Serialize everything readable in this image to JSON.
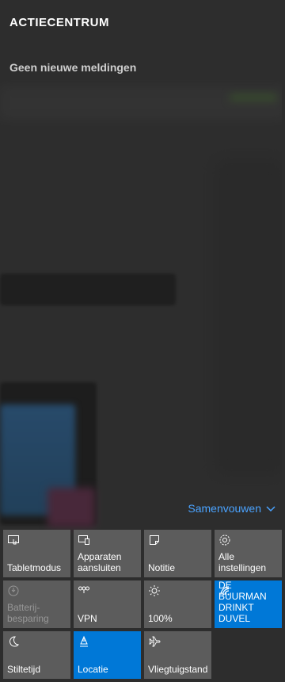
{
  "header": {
    "title": "ACTIECENTRUM"
  },
  "notifications": {
    "empty_text": "Geen nieuwe meldingen"
  },
  "collapse": {
    "label": "Samenvouwen"
  },
  "colors": {
    "accent": "#0078d7",
    "tile": "#5c5c5c",
    "link": "#4aa3ff"
  },
  "quick_actions": [
    {
      "label": "Tabletmodus",
      "icon": "tablet-mode-icon",
      "active": false,
      "disabled": false
    },
    {
      "label": "Apparaten aansluiten",
      "icon": "connect-devices-icon",
      "active": false,
      "disabled": false
    },
    {
      "label": "Notitie",
      "icon": "note-icon",
      "active": false,
      "disabled": false
    },
    {
      "label": "Alle instellingen",
      "icon": "gear-icon",
      "active": false,
      "disabled": false
    },
    {
      "label": "Batterij-besparing",
      "icon": "battery-saver-icon",
      "active": false,
      "disabled": true
    },
    {
      "label": "VPN",
      "icon": "vpn-icon",
      "active": false,
      "disabled": false
    },
    {
      "label": "100%",
      "icon": "brightness-icon",
      "active": false,
      "disabled": false
    },
    {
      "label": "DE BUURMAN DRINKT DUVEL",
      "icon": "wifi-icon",
      "active": true,
      "disabled": false
    },
    {
      "label": "Stiltetijd",
      "icon": "moon-icon",
      "active": false,
      "disabled": false
    },
    {
      "label": "Locatie",
      "icon": "location-icon",
      "active": true,
      "disabled": false
    },
    {
      "label": "Vliegtuigstand",
      "icon": "airplane-icon",
      "active": false,
      "disabled": false
    }
  ]
}
